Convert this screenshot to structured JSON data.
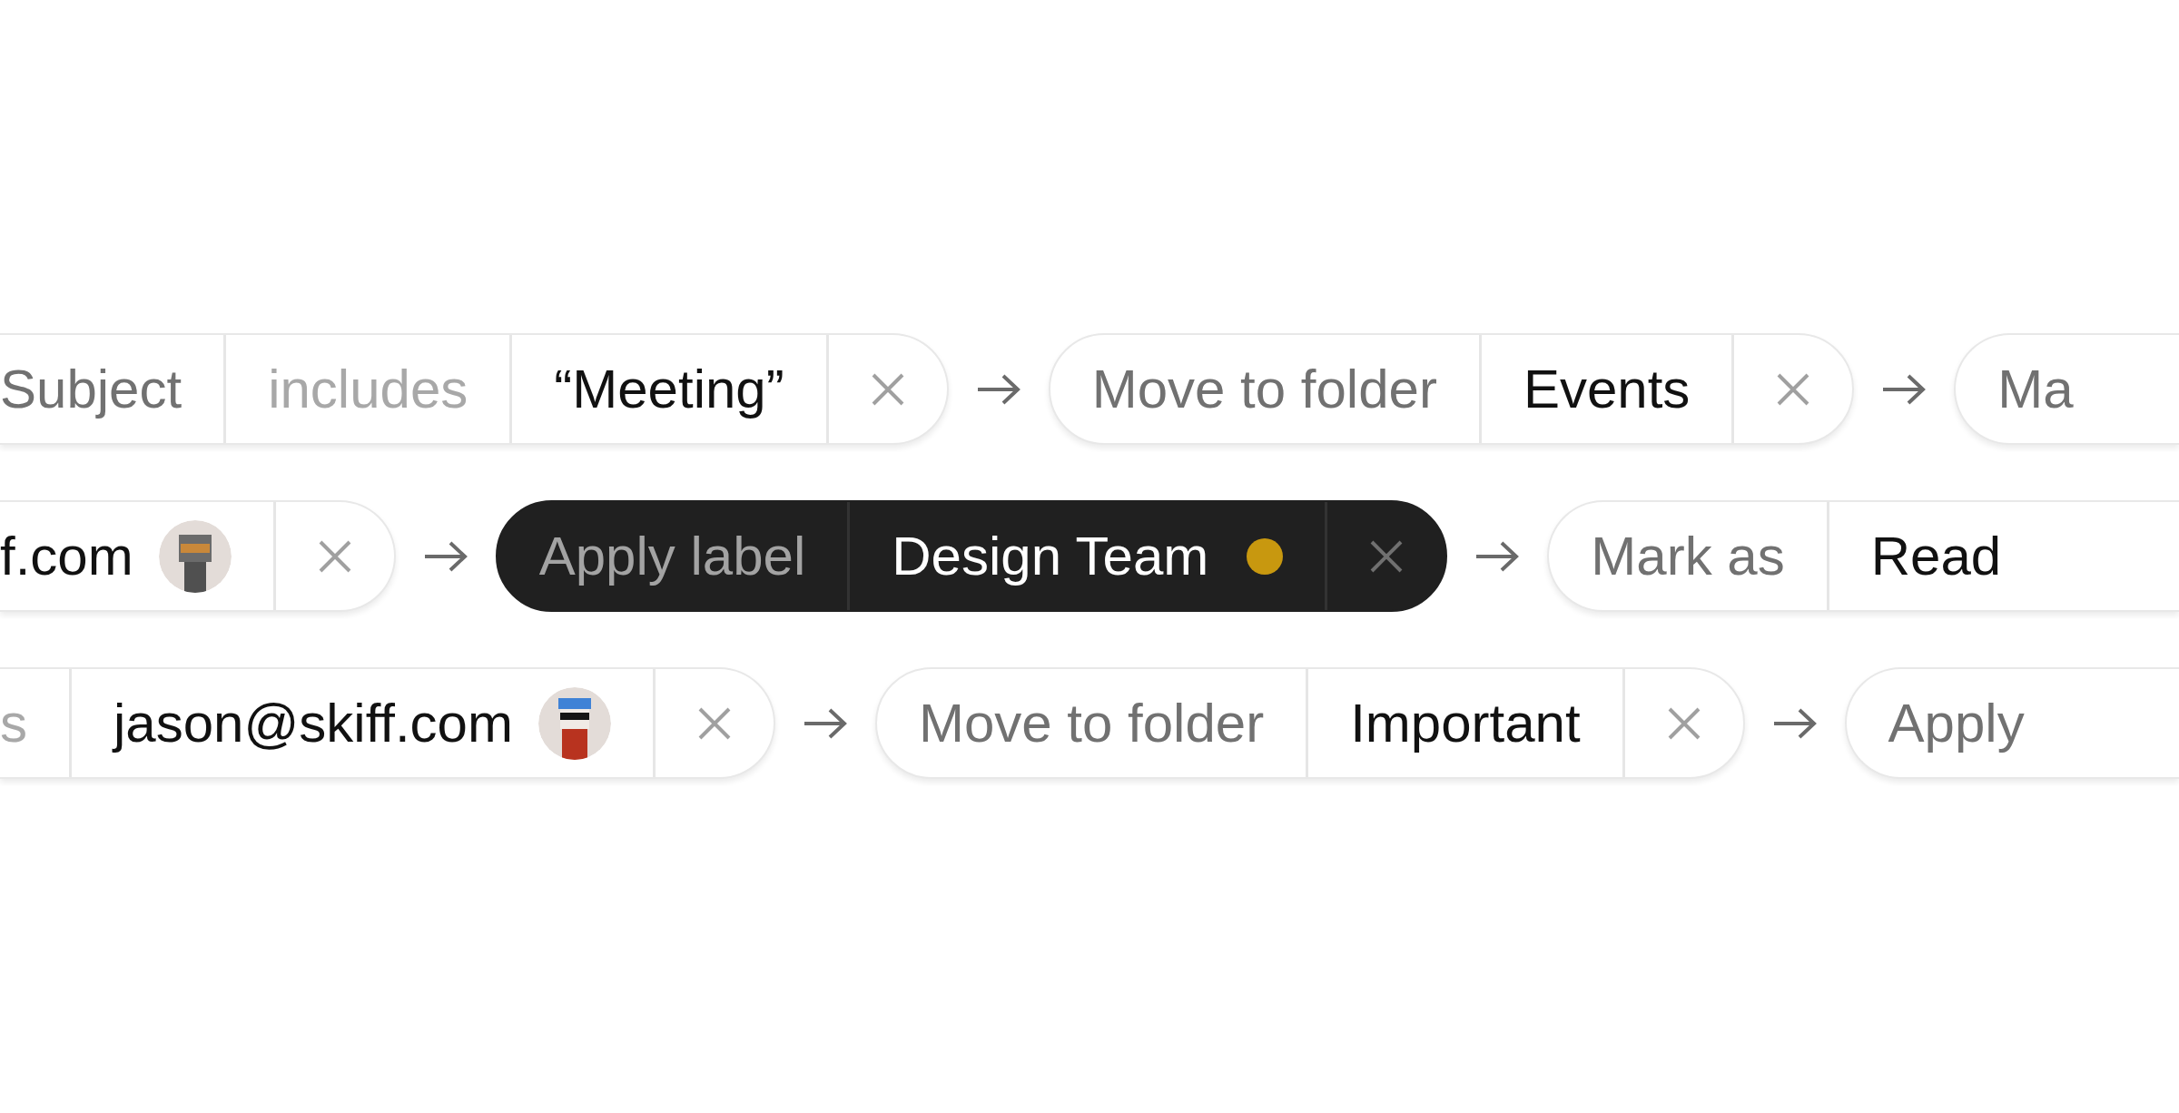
{
  "rows": [
    {
      "chips": [
        {
          "selected": false,
          "segments": [
            {
              "kind": "field",
              "text": "Subject"
            },
            {
              "kind": "operator",
              "text": "includes"
            },
            {
              "kind": "value",
              "text": "“Meeting”"
            },
            {
              "kind": "close"
            }
          ]
        },
        {
          "selected": false,
          "segments": [
            {
              "kind": "field",
              "text": "Move to folder"
            },
            {
              "kind": "value",
              "text": "Events"
            },
            {
              "kind": "close"
            }
          ]
        },
        {
          "selected": false,
          "segments": [
            {
              "kind": "field",
              "text": "Ma"
            }
          ]
        }
      ]
    },
    {
      "chips": [
        {
          "selected": false,
          "segments": [
            {
              "kind": "person",
              "text": "f.com"
            },
            {
              "kind": "close"
            }
          ]
        },
        {
          "selected": true,
          "segments": [
            {
              "kind": "field",
              "text": "Apply label"
            },
            {
              "kind": "value",
              "text": "Design Team",
              "color": "#c8980f"
            },
            {
              "kind": "close"
            }
          ]
        },
        {
          "selected": false,
          "segments": [
            {
              "kind": "field",
              "text": "Mark as"
            },
            {
              "kind": "value",
              "text": "Read"
            }
          ]
        }
      ]
    },
    {
      "chips": [
        {
          "selected": false,
          "segments": [
            {
              "kind": "operator",
              "text": "s"
            },
            {
              "kind": "person",
              "text": "jason@skiff.com"
            },
            {
              "kind": "close"
            }
          ]
        },
        {
          "selected": false,
          "segments": [
            {
              "kind": "field",
              "text": "Move to folder"
            },
            {
              "kind": "value",
              "text": "Important"
            },
            {
              "kind": "close"
            }
          ]
        },
        {
          "selected": false,
          "segments": [
            {
              "kind": "field",
              "text": "Apply"
            }
          ]
        }
      ]
    }
  ]
}
